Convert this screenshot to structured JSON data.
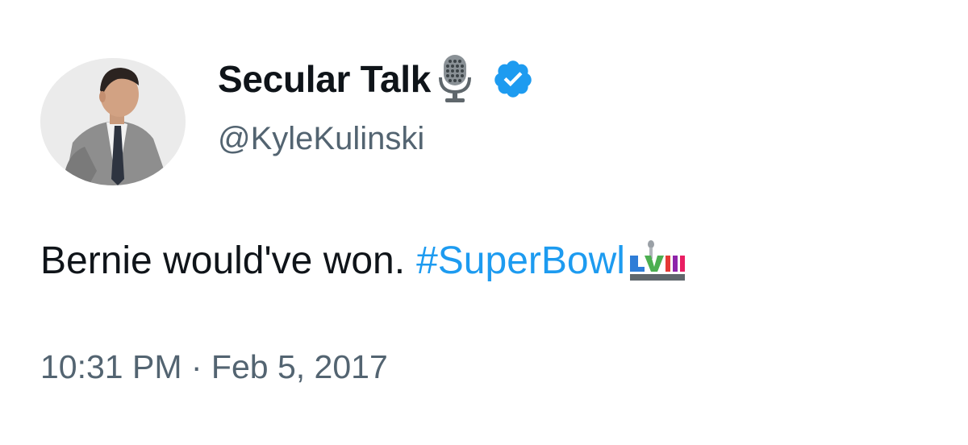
{
  "author": {
    "display_name": "Secular Talk",
    "handle": "@KyleKulinski",
    "name_emoji": "microphone-icon",
    "verified": true,
    "verified_color": "#1d9bf0"
  },
  "tweet": {
    "text": "Bernie would've won.",
    "hashtag": "#SuperBowl",
    "hashtag_emoji": "super-bowl-icon",
    "timestamp": "10:31 PM · Feb 5, 2017"
  },
  "colors": {
    "primary_text": "#0f1419",
    "secondary_text": "#536471",
    "link": "#1d9bf0",
    "background": "#ffffff"
  }
}
